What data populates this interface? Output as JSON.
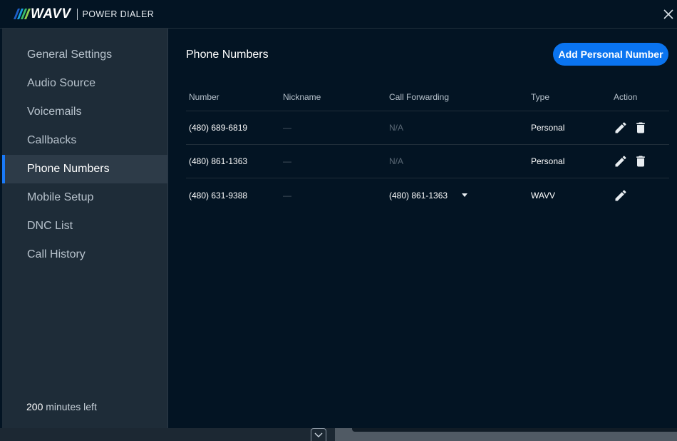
{
  "header": {
    "logo_text": "WAVV",
    "product_name": "POWER DIALER",
    "logo_stripe_colors": [
      "#1d5fc9",
      "#1aa0e0",
      "#3bc06a",
      "#8fd14f"
    ],
    "close_icon": "close-icon"
  },
  "sidebar": {
    "items": [
      {
        "label": "General Settings",
        "active": false
      },
      {
        "label": "Audio Source",
        "active": false
      },
      {
        "label": "Voicemails",
        "active": false
      },
      {
        "label": "Callbacks",
        "active": false
      },
      {
        "label": "Phone Numbers",
        "active": true
      },
      {
        "label": "Mobile Setup",
        "active": false
      },
      {
        "label": "DNC List",
        "active": false
      },
      {
        "label": "Call History",
        "active": false
      }
    ],
    "minutes_value": "200",
    "minutes_suffix": " minutes left"
  },
  "main": {
    "title": "Phone Numbers",
    "add_button_label": "Add Personal Number",
    "table": {
      "headers": {
        "number": "Number",
        "nickname": "Nickname",
        "call_forwarding": "Call Forwarding",
        "type": "Type",
        "action": "Action"
      },
      "rows": [
        {
          "number": "(480) 689-6819",
          "nickname": "—",
          "call_forwarding": "N/A",
          "type": "Personal"
        },
        {
          "number": "(480) 861-1363",
          "nickname": "—",
          "call_forwarding": "N/A",
          "type": "Personal"
        },
        {
          "number": "(480) 631-9388",
          "nickname": "—",
          "call_forwarding": "(480) 861-1363",
          "type": "WAVV"
        }
      ]
    }
  },
  "colors": {
    "accent": "#0a74f0",
    "background": "#031423",
    "sidebar": "#1e2c38"
  }
}
